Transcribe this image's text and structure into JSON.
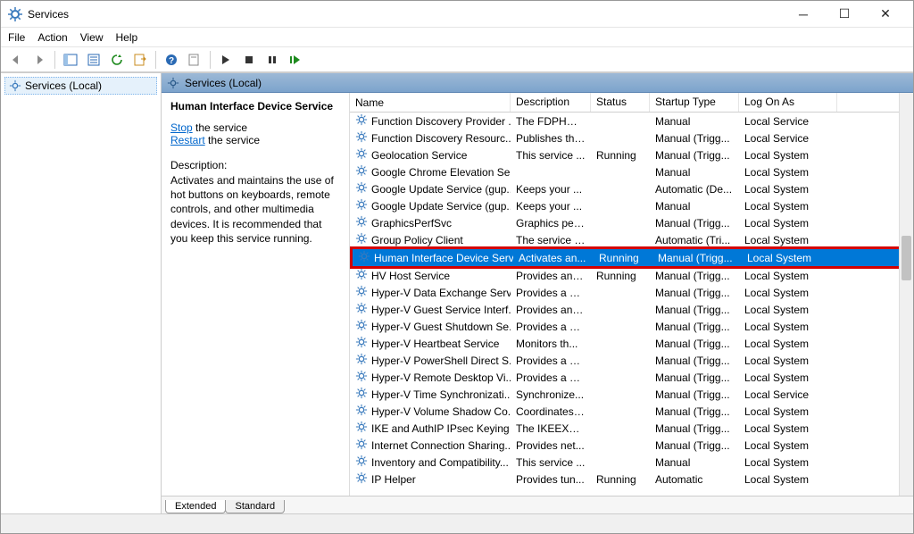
{
  "window": {
    "title": "Services"
  },
  "menu": {
    "file": "File",
    "action": "Action",
    "view": "View",
    "help": "Help"
  },
  "tree": {
    "root": "Services (Local)"
  },
  "pane": {
    "title": "Services (Local)"
  },
  "detail": {
    "heading": "Human Interface Device Service",
    "stop_link": "Stop",
    "stop_suffix": " the service",
    "restart_link": "Restart",
    "restart_suffix": " the service",
    "desc_label": "Description:",
    "desc": "Activates and maintains the use of hot buttons on keyboards, remote controls, and other multimedia devices. It is recommended that you keep this service running."
  },
  "columns": {
    "name": "Name",
    "description": "Description",
    "status": "Status",
    "startup": "Startup Type",
    "logon": "Log On As"
  },
  "tabs": {
    "extended": "Extended",
    "standard": "Standard"
  },
  "services": [
    {
      "name": "Function Discovery Provider ...",
      "desc": "The FDPHOS...",
      "status": "",
      "startup": "Manual",
      "logon": "Local Service"
    },
    {
      "name": "Function Discovery Resourc...",
      "desc": "Publishes thi...",
      "status": "",
      "startup": "Manual (Trigg...",
      "logon": "Local Service"
    },
    {
      "name": "Geolocation Service",
      "desc": "This service ...",
      "status": "Running",
      "startup": "Manual (Trigg...",
      "logon": "Local System"
    },
    {
      "name": "Google Chrome Elevation Se...",
      "desc": "",
      "status": "",
      "startup": "Manual",
      "logon": "Local System"
    },
    {
      "name": "Google Update Service (gup...",
      "desc": "Keeps your ...",
      "status": "",
      "startup": "Automatic (De...",
      "logon": "Local System"
    },
    {
      "name": "Google Update Service (gup...",
      "desc": "Keeps your ...",
      "status": "",
      "startup": "Manual",
      "logon": "Local System"
    },
    {
      "name": "GraphicsPerfSvc",
      "desc": "Graphics per...",
      "status": "",
      "startup": "Manual (Trigg...",
      "logon": "Local System"
    },
    {
      "name": "Group Policy Client",
      "desc": "The service i...",
      "status": "",
      "startup": "Automatic (Tri...",
      "logon": "Local System"
    },
    {
      "name": "Human Interface Device Serv...",
      "desc": "Activates an...",
      "status": "Running",
      "startup": "Manual (Trigg...",
      "logon": "Local System",
      "selected": true
    },
    {
      "name": "HV Host Service",
      "desc": "Provides an i...",
      "status": "Running",
      "startup": "Manual (Trigg...",
      "logon": "Local System"
    },
    {
      "name": "Hyper-V Data Exchange Serv...",
      "desc": "Provides a m...",
      "status": "",
      "startup": "Manual (Trigg...",
      "logon": "Local System"
    },
    {
      "name": "Hyper-V Guest Service Interf...",
      "desc": "Provides an i...",
      "status": "",
      "startup": "Manual (Trigg...",
      "logon": "Local System"
    },
    {
      "name": "Hyper-V Guest Shutdown Se...",
      "desc": "Provides a m...",
      "status": "",
      "startup": "Manual (Trigg...",
      "logon": "Local System"
    },
    {
      "name": "Hyper-V Heartbeat Service",
      "desc": "Monitors th...",
      "status": "",
      "startup": "Manual (Trigg...",
      "logon": "Local System"
    },
    {
      "name": "Hyper-V PowerShell Direct S...",
      "desc": "Provides a m...",
      "status": "",
      "startup": "Manual (Trigg...",
      "logon": "Local System"
    },
    {
      "name": "Hyper-V Remote Desktop Vi...",
      "desc": "Provides a pl...",
      "status": "",
      "startup": "Manual (Trigg...",
      "logon": "Local System"
    },
    {
      "name": "Hyper-V Time Synchronizati...",
      "desc": "Synchronize...",
      "status": "",
      "startup": "Manual (Trigg...",
      "logon": "Local Service"
    },
    {
      "name": "Hyper-V Volume Shadow Co...",
      "desc": "Coordinates ...",
      "status": "",
      "startup": "Manual (Trigg...",
      "logon": "Local System"
    },
    {
      "name": "IKE and AuthIP IPsec Keying ...",
      "desc": "The IKEEXT s...",
      "status": "",
      "startup": "Manual (Trigg...",
      "logon": "Local System"
    },
    {
      "name": "Internet Connection Sharing...",
      "desc": "Provides net...",
      "status": "",
      "startup": "Manual (Trigg...",
      "logon": "Local System"
    },
    {
      "name": "Inventory and Compatibility...",
      "desc": "This service ...",
      "status": "",
      "startup": "Manual",
      "logon": "Local System"
    },
    {
      "name": "IP Helper",
      "desc": "Provides tun...",
      "status": "Running",
      "startup": "Automatic",
      "logon": "Local System"
    }
  ]
}
